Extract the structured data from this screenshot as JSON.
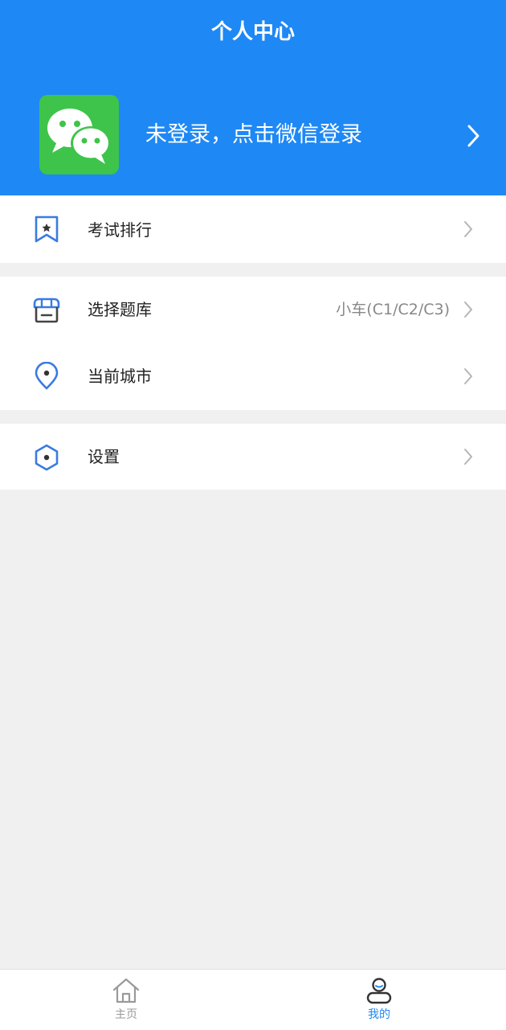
{
  "header": {
    "title": "个人中心",
    "login_text": "未登录，点击微信登录"
  },
  "menu": {
    "exam_ranking": {
      "label": "考试排行"
    },
    "question_bank": {
      "label": "选择题库",
      "value": "小车(C1/C2/C3)"
    },
    "current_city": {
      "label": "当前城市"
    },
    "settings": {
      "label": "设置"
    }
  },
  "tabbar": {
    "home": {
      "label": "主页"
    },
    "mine": {
      "label": "我的"
    }
  },
  "colors": {
    "header_bg": "#1e88f5",
    "wechat_green": "#3ec44a",
    "icon_blue": "#3a7be0",
    "active_tab": "#1e88f5",
    "inactive_tab": "#9a9a9a",
    "page_bg": "#f0f0f0"
  },
  "icons": {
    "wechat": "wechat-logo-icon",
    "exam_ranking": "bookmark-star-icon",
    "question_bank": "store-icon",
    "current_city": "location-pin-icon",
    "settings": "hexagon-gear-icon",
    "home": "house-icon",
    "mine": "person-icon",
    "chevron": "chevron-right-icon"
  }
}
